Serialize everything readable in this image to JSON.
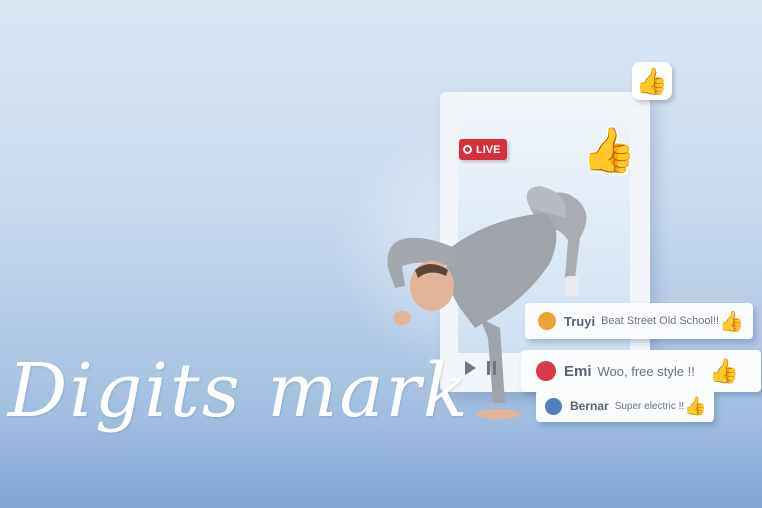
{
  "live_badge": "LIVE",
  "brand": "Digits mark",
  "comments": [
    {
      "name": "Truyi",
      "message": "Beat Street Old School!!"
    },
    {
      "name": "Emi",
      "message": "Woo, free style !!"
    },
    {
      "name": "Bernar",
      "message": "Super electric !!"
    }
  ],
  "icons": {
    "like": "thumbs-up-icon",
    "play": "play-icon",
    "pause": "pause-icon"
  },
  "colors": {
    "live_red": "#d6303a",
    "like_blue": "#4169b0",
    "avatar_orange": "#e9a53a",
    "avatar_red": "#d83a4a",
    "avatar_blue": "#4f7fc2"
  }
}
